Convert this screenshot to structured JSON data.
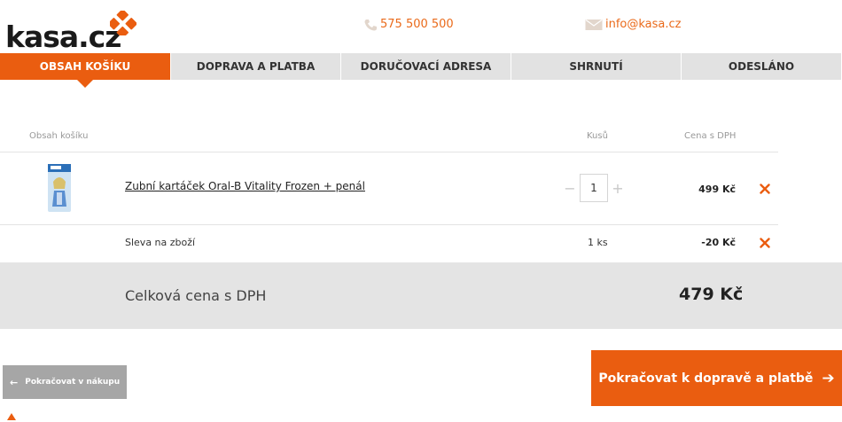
{
  "brand": {
    "logo_text": "kasa.cz",
    "accent": "#ea5d10"
  },
  "contact": {
    "phone": "575 500 500",
    "email": "info@kasa.cz"
  },
  "steps": [
    "OBSAH KOŠÍKU",
    "DOPRAVA A PLATBA",
    "DORUČOVACÍ ADRESA",
    "SHRNUTÍ",
    "ODESLÁNO"
  ],
  "cart": {
    "header_item": "Obsah košíku",
    "header_qty": "Kusů",
    "header_price": "Cena s DPH",
    "product": {
      "name": "Zubní kartáček Oral-B Vitality Frozen + penál",
      "qty": "1",
      "price": "499 Kč"
    },
    "discount": {
      "label": "Sleva na zboží",
      "qty": "1 ks",
      "price": "-20 Kč"
    },
    "total_label": "Celková cena s DPH",
    "total_value": "479 Kč"
  },
  "buttons": {
    "back": "Pokračovat v nákupu",
    "next": "Pokračovat k dopravě a platbě"
  }
}
